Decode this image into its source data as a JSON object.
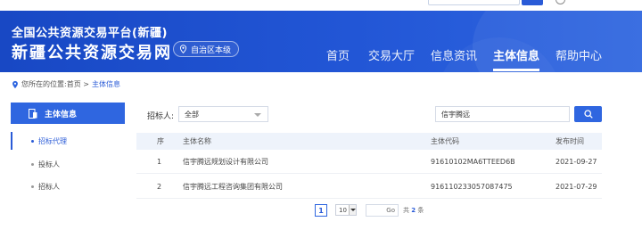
{
  "colors": {
    "header": "#2256d6",
    "accent": "#2f66e0",
    "link": "#2a5bd7"
  },
  "header": {
    "subtitle": "全国公共资源交易平台(新疆)",
    "title": "新疆公共资源交易网",
    "region": "自治区本级",
    "nav": [
      {
        "label": "首页",
        "active": false
      },
      {
        "label": "交易大厅",
        "active": false
      },
      {
        "label": "信息资讯",
        "active": false
      },
      {
        "label": "主体信息",
        "active": true
      },
      {
        "label": "帮助中心",
        "active": false
      }
    ]
  },
  "breadcrumb": {
    "prefix": "您所在的位置:首页 >",
    "current": "主体信息"
  },
  "sidebar": {
    "heading": "主体信息",
    "items": [
      {
        "label": "招标代理",
        "active": true
      },
      {
        "label": "投标人",
        "active": false
      },
      {
        "label": "招标人",
        "active": false
      }
    ]
  },
  "filter": {
    "label": "招标人:",
    "selected": "全部",
    "search_value": "信宇腾远"
  },
  "table": {
    "headers": {
      "seq": "序",
      "name": "主体名称",
      "code": "主体代码",
      "date": "发布时间"
    },
    "rows": [
      {
        "seq": "1",
        "name": "信宇腾远规划设计有限公司",
        "code": "91610102MA6TTEED6B",
        "date": "2021-09-27"
      },
      {
        "seq": "2",
        "name": "信宇腾远工程咨询集团有限公司",
        "code": "916110233057087475",
        "date": "2021-07-29"
      }
    ]
  },
  "pagination": {
    "current_page": "1",
    "page_size": "10",
    "jump_label": "Go",
    "total_prefix": "共",
    "total": "2",
    "total_suffix": "条"
  }
}
